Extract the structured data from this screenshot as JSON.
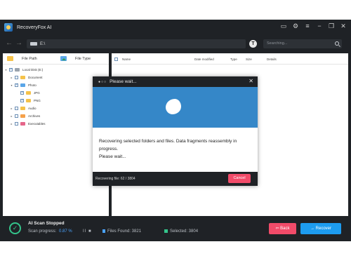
{
  "app": {
    "title": "RecoveryFox AI"
  },
  "titlebar_icons": [
    "chat-icon",
    "settings-icon",
    "menu-icon",
    "minimize-icon",
    "restore-icon",
    "close-icon"
  ],
  "nav": {
    "path": "E:\\",
    "search_placeholder": "Searching..."
  },
  "left_panel": {
    "col_file_path": "File Path",
    "col_file_type": "File Type",
    "tree": [
      {
        "label": "Local Disk (E:)",
        "level": 0,
        "expanded": true,
        "checked": true
      },
      {
        "label": "Document",
        "level": 1,
        "expanded": false,
        "checked": false
      },
      {
        "label": "Photo",
        "level": 1,
        "expanded": true,
        "checked": true
      },
      {
        "label": "JPG",
        "level": 2,
        "expanded": false,
        "checked": true
      },
      {
        "label": "PNG",
        "level": 2,
        "expanded": false,
        "checked": true
      },
      {
        "label": "Audio",
        "level": 1,
        "expanded": false,
        "checked": false
      },
      {
        "label": "Archives",
        "level": 1,
        "expanded": false,
        "checked": false
      },
      {
        "label": "Executables",
        "level": 1,
        "expanded": false,
        "checked": false
      }
    ]
  },
  "right_panel": {
    "columns": [
      "Name",
      "Date modified",
      "Type",
      "Size",
      "Details"
    ]
  },
  "status": {
    "title": "AI Scan Stopped",
    "progress_label": "Scan progress:",
    "progress_value": "0.87 %",
    "pause_glyph": "II ■",
    "files_found": "Files Found: 3821",
    "selected": "Selected:  3804",
    "back_label": "Back",
    "recover_label": "Recover"
  },
  "dialog": {
    "title": "Please wait...",
    "message_line1": "Recovering selected folders and files. Data fragments reassembly in progress.",
    "message_line2": "Please wait...",
    "recovering_status": "Recovering file: 62 / 3804",
    "cancel_label": "Cancel"
  },
  "colors": {
    "window_bg": "#1f2226",
    "accent_blue": "#1d9cf0",
    "danger_pink": "#f14b69",
    "success_green": "#34c48b",
    "dialog_banner": "#3587c8"
  }
}
